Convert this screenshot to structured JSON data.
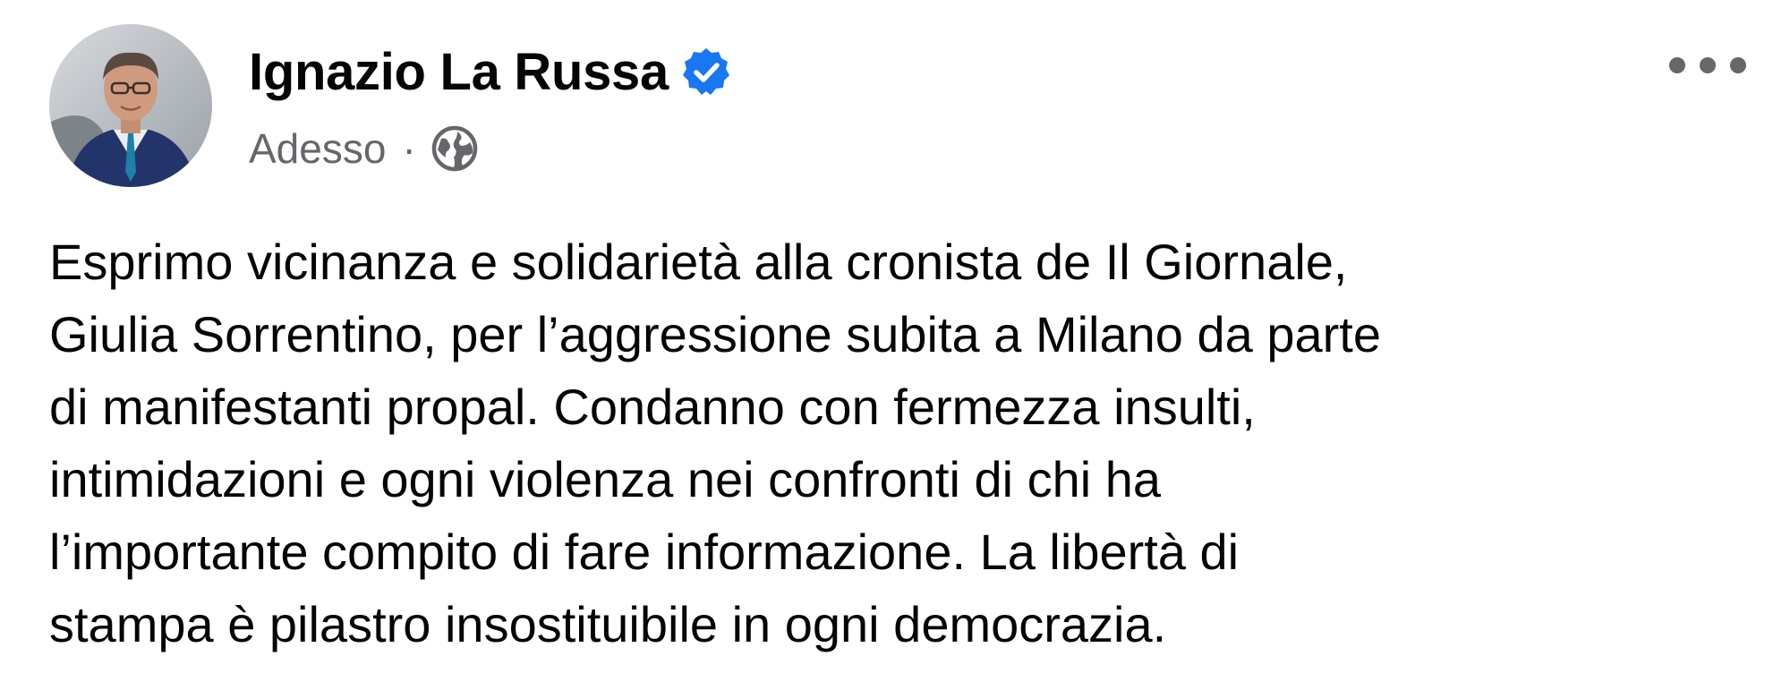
{
  "post": {
    "author": {
      "name": "Ignazio La Russa",
      "verified": true
    },
    "timestamp": "Adesso",
    "separator": "·",
    "audience_icon": "globe-icon",
    "more_icon": "more-options-icon",
    "text_lines": [
      "Esprimo vicinanza e solidarietà alla cronista de Il Giornale,",
      "Giulia Sorrentino, per l’aggressione subita a Milano da parte",
      "di manifestanti propal. Condanno con fermezza insulti,",
      "intimidazioni e ogni violenza nei confronti di chi ha",
      "l’importante compito di fare informazione. La libertà di",
      "stampa è pilastro insostituibile in ogni democrazia."
    ]
  },
  "colors": {
    "name": "#050505",
    "meta": "#65676b",
    "verified_badge": "#1877f2",
    "background": "#ffffff"
  }
}
